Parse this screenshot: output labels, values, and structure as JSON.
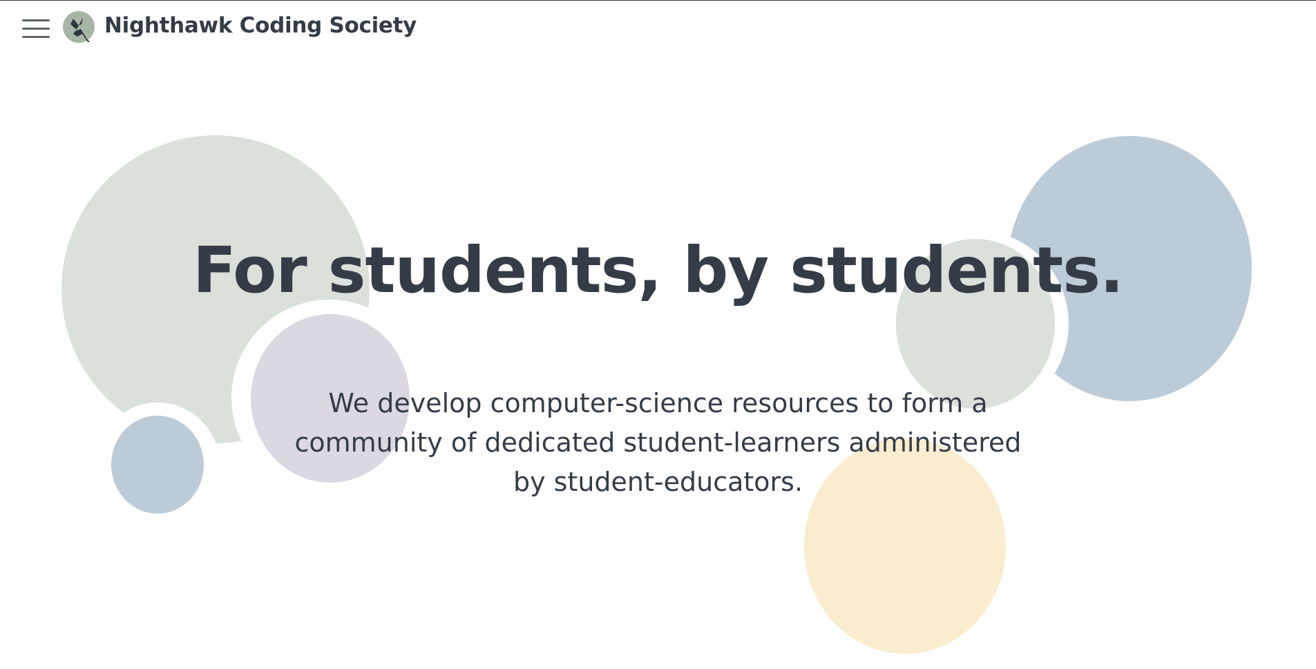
{
  "header": {
    "brand": "Nighthawk Coding Society",
    "menu_icon": "hamburger-menu-icon",
    "logo_icon": "nighthawk-bird-logo"
  },
  "hero": {
    "title": "For students, by students.",
    "subtitle": "We develop computer-science resources to form a community of dedicated student-learners administered by student-educators."
  },
  "colors": {
    "text": "#343c48",
    "sage": "#dae0da",
    "blue": "#bccbd8",
    "lavender": "#dbd8e1",
    "cream": "#faedcf"
  }
}
